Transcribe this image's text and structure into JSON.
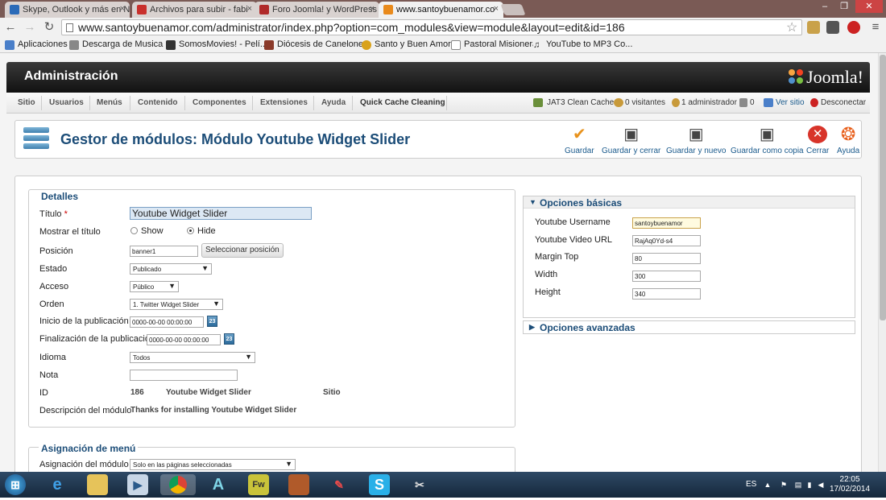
{
  "browser": {
    "tabs": [
      {
        "label": "Skype, Outlook y más en N",
        "color": "#2a6ab8"
      },
      {
        "label": "Archivos para subir - fabi",
        "color": "#c9302c"
      },
      {
        "label": "Foro Joomla! y WordPress",
        "color": "#b02a2a"
      },
      {
        "label": "www.santoybuenamor.co",
        "color": "#e98a1c"
      }
    ],
    "url": "www.santoybuenamor.com/administrator/index.php?option=com_modules&view=module&layout=edit&id=186",
    "bookmarks": [
      "Aplicaciones",
      "Descarga de Musica ...",
      "SomosMovies! - Pelí...",
      "Diócesis de Canelones",
      "Santo y Buen Amor",
      "Pastoral Misionera",
      "YouTube to MP3 Co..."
    ]
  },
  "joomla": {
    "admin_title": "Administración",
    "logo_text": "Joomla!",
    "menu": [
      "Sitio",
      "Usuarios",
      "Menús",
      "Contenido",
      "Componentes",
      "Extensiones",
      "Ayuda",
      "Quick Cache Cleaning"
    ],
    "status": {
      "cache": "JAT3 Clean Cache",
      "visitors": "0 visitantes",
      "admins": "1 administrador",
      "messages": "0",
      "view_site": "Ver sitio",
      "logout": "Desconectar"
    },
    "page_title": "Gestor de módulos: Módulo Youtube Widget Slider",
    "toolbar": [
      "Guardar",
      "Guardar y cerrar",
      "Guardar y nuevo",
      "Guardar como copia",
      "Cerrar",
      "Ayuda"
    ],
    "details": {
      "legend": "Detalles",
      "title_label": "Título",
      "title_required": "*",
      "title_value": "Youtube Widget Slider",
      "show_title_label": "Mostrar el título",
      "show_option": "Show",
      "hide_option": "Hide",
      "position_label": "Posición",
      "position_value": "banner1",
      "position_button": "Seleccionar posición",
      "state_label": "Estado",
      "state_value": "Publicado",
      "access_label": "Acceso",
      "access_value": "Público",
      "order_label": "Orden",
      "order_value": "1. Twitter Widget Slider",
      "publish_up_label": "Inicio de la publicación",
      "publish_up_value": "0000-00-00 00:00:00",
      "publish_down_label": "Finalización de la publicación",
      "publish_down_value": "0000-00-00 00:00:00",
      "calendar_label": "23",
      "language_label": "Idioma",
      "language_value": "Todos",
      "note_label": "Nota",
      "note_value": "",
      "id_label": "ID",
      "id_value": "186",
      "module_name": "Youtube Widget Slider",
      "client": "Sitio",
      "desc_label": "Descripción del módulo",
      "desc_value": "Thanks for installing Youtube Widget Slider"
    },
    "menu_assignment": {
      "legend": "Asignación de menú",
      "label": "Asignación del módulo",
      "value": "Solo en las páginas seleccionadas"
    },
    "basic_options": {
      "title": "Opciones básicas",
      "fields": [
        {
          "label": "Youtube Username",
          "value": "santoybuenamor"
        },
        {
          "label": "Youtube Video URL",
          "value": "RajAq0Yd-s4"
        },
        {
          "label": "Margin Top",
          "value": "80"
        },
        {
          "label": "Width",
          "value": "300"
        },
        {
          "label": "Height",
          "value": "340"
        }
      ]
    },
    "advanced_options": {
      "title": "Opciones avanzadas"
    }
  },
  "taskbar": {
    "lang": "ES",
    "time": "22:05",
    "date": "17/02/2014"
  }
}
